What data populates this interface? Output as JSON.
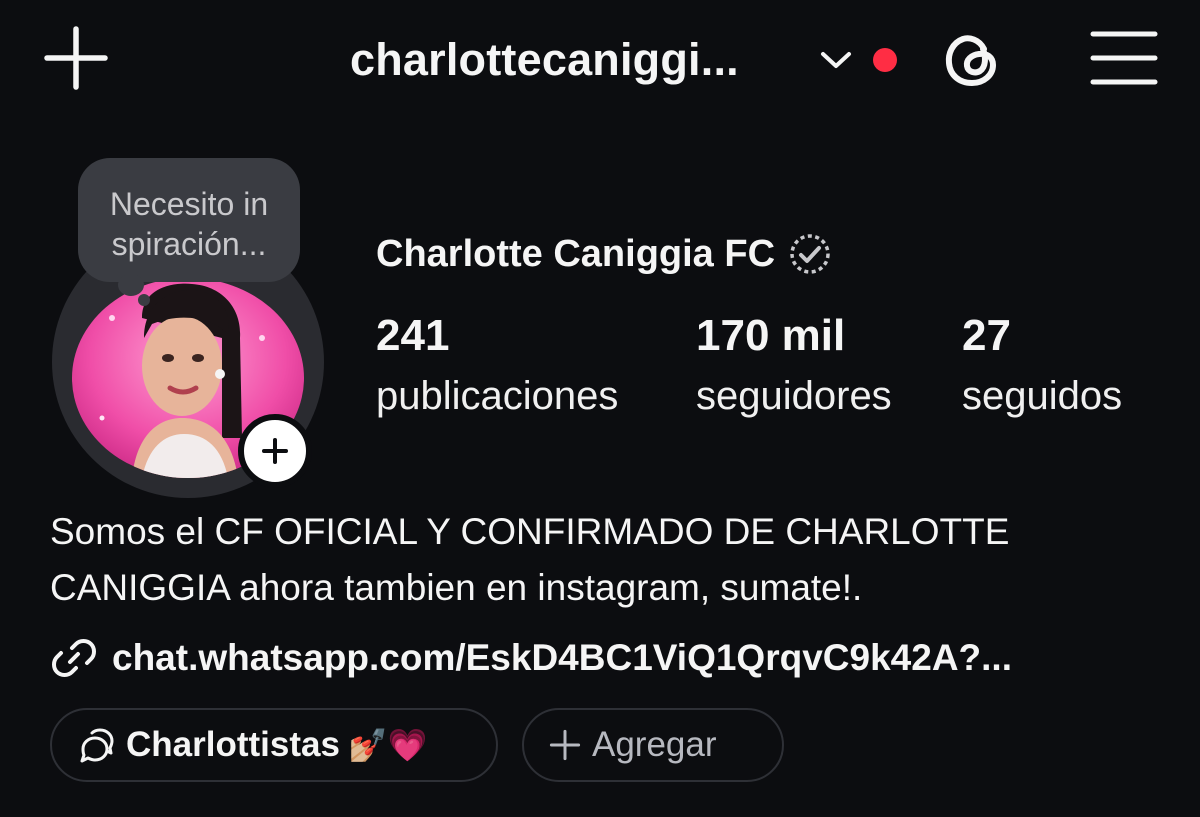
{
  "header": {
    "username": "charlottecaniggi...",
    "icons": {
      "new_post": "plus-icon",
      "switch_account": "chevron-down-icon",
      "notification": "red-dot-indicator",
      "threads": "threads-icon",
      "menu": "hamburger-menu-icon"
    },
    "accent_color": "#ff2d44"
  },
  "profile": {
    "note": "Necesito in spiración...",
    "display_name": "Charlotte Caniggia FC",
    "verified_icon": "verified-badge-icon",
    "stats": {
      "posts_count": "241",
      "posts_label": "publicaciones",
      "followers_count": "170 mil",
      "followers_label": "seguidores",
      "following_count": "27",
      "following_label": "seguidos"
    },
    "add_story_icon": "plus-icon"
  },
  "bio": {
    "text": "Somos el CF OFICIAL Y CONFIRMADO DE CHARLOTTE CANIGGIA ahora tambien en instagram, sumate!.",
    "link_icon": "link-icon",
    "link": "chat.whatsapp.com/EskD4BC1ViQ1QrqvC9k42A?..."
  },
  "chips": {
    "channel_icon": "broadcast-channel-icon",
    "channel_label": "Charlottistas",
    "channel_emoji": "💅🏼💗",
    "add_label": "Agregar"
  }
}
